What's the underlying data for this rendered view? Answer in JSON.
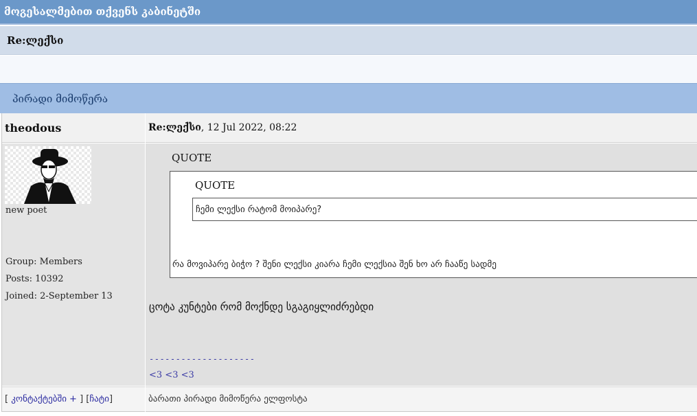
{
  "header": {
    "welcome": "მოგესალმებით თქვენს კაბინეტში",
    "thread_title": "Re:ლექსი",
    "section_title": "პირადი მიმოწერა"
  },
  "post": {
    "author": "theodous",
    "title_bold": "Re:ლექსი",
    "date": ", 12 Jul 2022, 08:22",
    "avatar_icon": "man-with-hat-avatar",
    "user_title": "new poet",
    "group": "Group: Members",
    "posts": "Posts: 10392",
    "joined": "Joined: 2-September 13",
    "outer_quote_label": "QUOTE",
    "inner_quote_label": "QUOTE",
    "inner_quote_text": "ჩემი ლექსი რატომ მოიპარე?",
    "outer_quote_text": "რა მოვიპარე ბიჭო ? შენი ლექსი კიარა ჩემი ლექსია შენ ხო არ ჩააწე სადმე",
    "body": "ცოტა კუნტები რომ მოქნდე სგაგიყლიძრებდი",
    "signature_rule": "--------------------",
    "signature": "<3 <3 <3"
  },
  "footer": {
    "bracket_open": "[ ",
    "contacts_link": "კონტაქტებში +",
    "middle": " ] [",
    "chat_link": "ჩატი",
    "bracket_close": "]",
    "actions": "ბარათი პირადი მიმოწერა ელფოსტა"
  }
}
